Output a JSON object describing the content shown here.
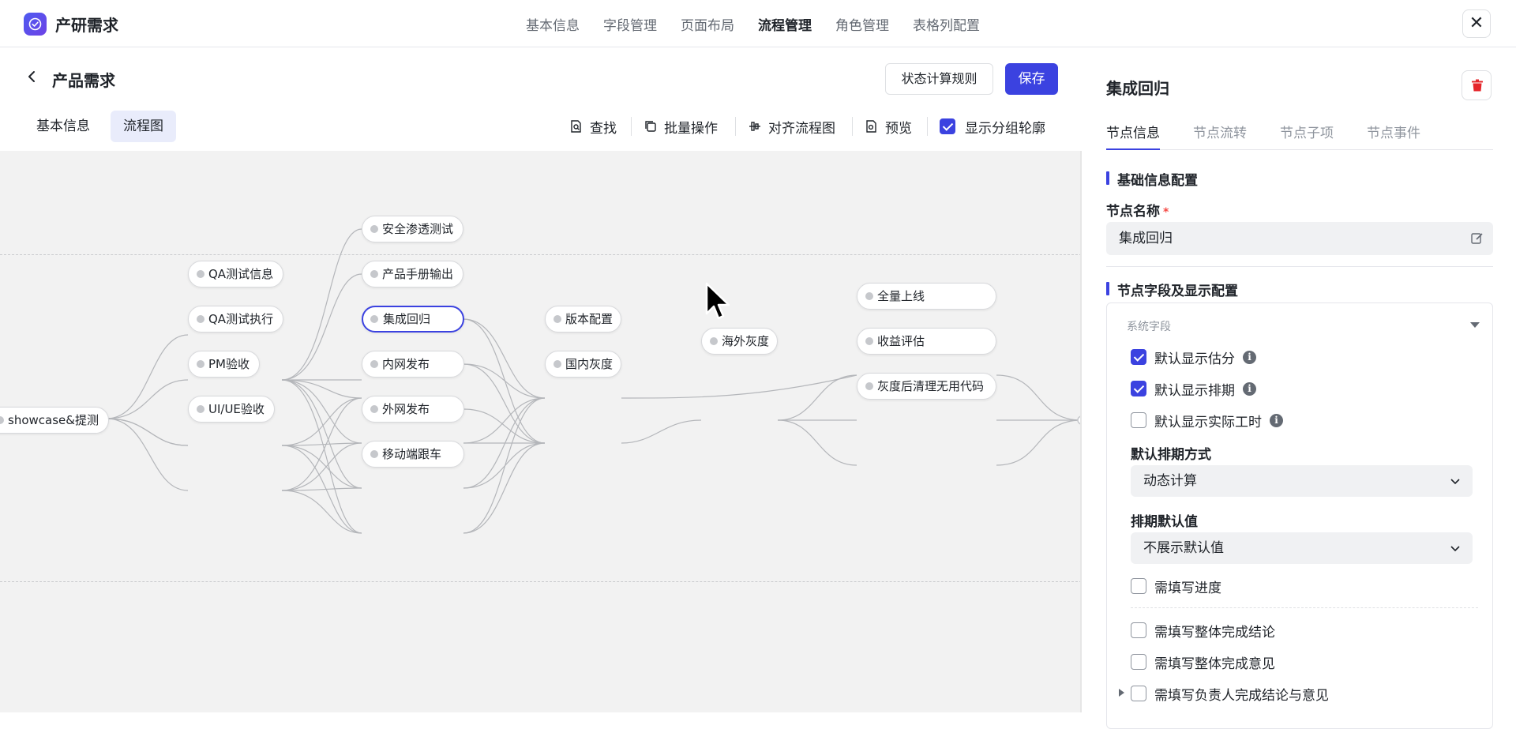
{
  "app": {
    "title": "产研需求",
    "logo_icon": "check-circle-icon"
  },
  "top_nav": [
    "基本信息",
    "字段管理",
    "页面布局",
    "流程管理",
    "角色管理",
    "表格列配置"
  ],
  "top_nav_active": "流程管理",
  "header": {
    "page_title": "产品需求",
    "rule_button": "状态计算规则",
    "save_button": "保存"
  },
  "tabs": {
    "basic": "基本信息",
    "flow": "流程图"
  },
  "toolbar": {
    "find": "查找",
    "batch": "批量操作",
    "align": "对齐流程图",
    "preview": "预览",
    "show_group": "显示分组轮廓",
    "show_group_checked": true
  },
  "flow": {
    "nodes": {
      "showcase": "showcase&提测",
      "qa_info": "QA测试信息",
      "qa_exec": "QA测试执行",
      "pm_accept": "PM验收",
      "uiue_accept": "UI/UE验收",
      "security": "安全渗透测试",
      "manual": "产品手册输出",
      "integration": "集成回归",
      "intranet": "内网发布",
      "extranet": "外网发布",
      "mobile": "移动端跟车",
      "version_cfg": "版本配置",
      "domestic_gray": "国内灰度",
      "overseas_gray": "海外灰度",
      "full_launch": "全量上线",
      "revenue_eval": "收益评估",
      "cleanup": "灰度后清理无用代码"
    },
    "selected": "集成回归"
  },
  "panel": {
    "title": "集成回归",
    "tabs": [
      "节点信息",
      "节点流转",
      "节点子项",
      "节点事件"
    ],
    "active_tab": "节点信息",
    "basic_section": "基础信息配置",
    "name_label": "节点名称",
    "required_mark": "*",
    "name_value": "集成回归",
    "field_section": "节点字段及显示配置",
    "system_fields": "系统字段",
    "checkboxes": [
      {
        "label": "默认显示估分",
        "checked": true,
        "info": true
      },
      {
        "label": "默认显示排期",
        "checked": true,
        "info": true
      },
      {
        "label": "默认显示实际工时",
        "checked": false,
        "info": true
      }
    ],
    "schedule_mode_label": "默认排期方式",
    "schedule_mode_value": "动态计算",
    "schedule_default_label": "排期默认值",
    "schedule_default_value": "不展示默认值",
    "progress_required": "需填写进度",
    "more_checkboxes": [
      "需填写整体完成结论",
      "需填写整体完成意见",
      "需填写负责人完成结论与意见"
    ]
  },
  "colors": {
    "accent": "#3b42e0",
    "danger": "#e5252a"
  }
}
